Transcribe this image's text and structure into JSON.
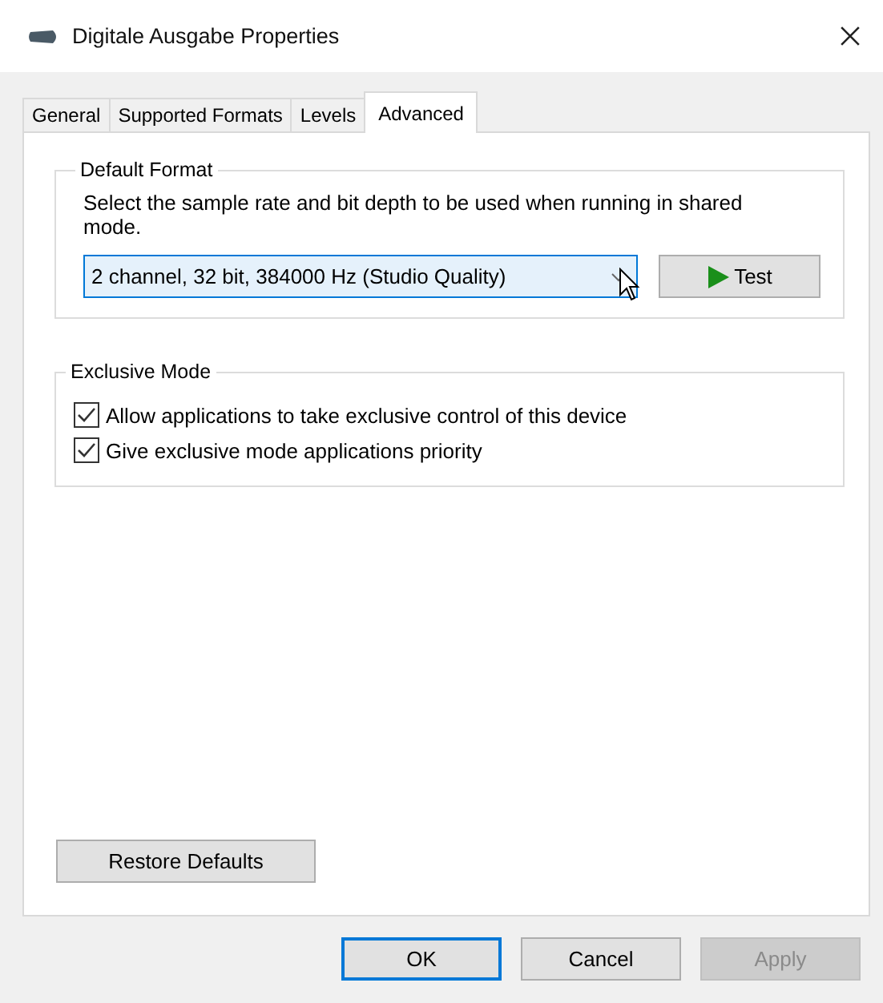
{
  "window": {
    "title": "Digitale Ausgabe Properties"
  },
  "tabs": [
    {
      "label": "General",
      "selected": false
    },
    {
      "label": "Supported Formats",
      "selected": false
    },
    {
      "label": "Levels",
      "selected": false
    },
    {
      "label": "Advanced",
      "selected": true
    }
  ],
  "default_format": {
    "title": "Default Format",
    "description": "Select the sample rate and bit depth to be used when running in shared mode.",
    "dropdown": {
      "value": "2 channel, 32 bit, 384000 Hz (Studio Quality)",
      "hovered": true
    },
    "test_button": {
      "label": "Test"
    }
  },
  "exclusive_mode": {
    "title": "Exclusive Mode",
    "options": [
      {
        "label": "Allow applications to take exclusive control of this device",
        "checked": true
      },
      {
        "label": "Give exclusive mode applications priority",
        "checked": true
      }
    ]
  },
  "restore_button": {
    "label": "Restore Defaults"
  },
  "buttons": [
    {
      "label": "OK",
      "default": true,
      "disabled": false
    },
    {
      "label": "Cancel",
      "default": false,
      "disabled": false
    },
    {
      "label": "Apply",
      "default": false,
      "disabled": true
    }
  ]
}
